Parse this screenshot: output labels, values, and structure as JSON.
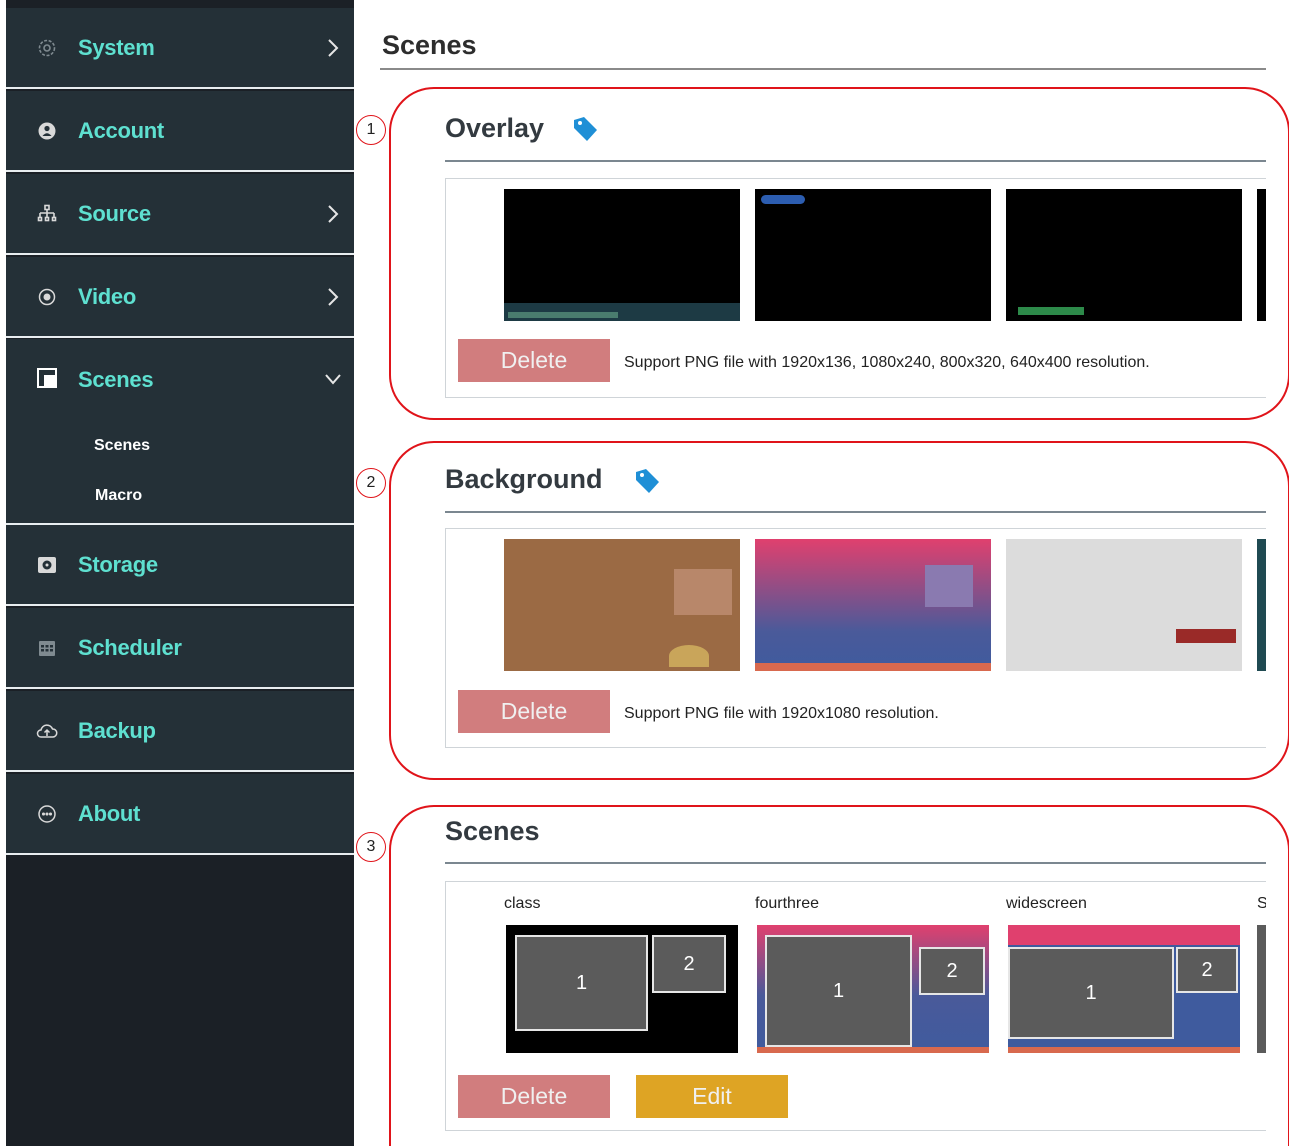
{
  "sidebar": {
    "items": [
      {
        "label": "System",
        "icon": "gear-icon"
      },
      {
        "label": "Account",
        "icon": "user-icon"
      },
      {
        "label": "Source",
        "icon": "network-icon"
      },
      {
        "label": "Video",
        "icon": "record-icon"
      },
      {
        "label": "Scenes",
        "icon": "scenes-icon",
        "expanded": true,
        "children": [
          "Scenes",
          "Macro"
        ]
      },
      {
        "label": "Storage",
        "icon": "disk-icon"
      },
      {
        "label": "Scheduler",
        "icon": "calendar-icon"
      },
      {
        "label": "Backup",
        "icon": "cloud-upload-icon"
      },
      {
        "label": "About",
        "icon": "chat-icon"
      }
    ],
    "accent_color": "#5ee0d0"
  },
  "main": {
    "title": "Scenes",
    "overlay": {
      "title": "Overlay",
      "delete_label": "Delete",
      "support_text": "Support PNG file with 1920x136, 1080x240, 800x320, 640x400 resolution.",
      "marker": "1"
    },
    "background": {
      "title": "Background",
      "delete_label": "Delete",
      "support_text": "Support PNG file with 1920x1080 resolution.",
      "marker": "2"
    },
    "scenes": {
      "title": "Scenes",
      "delete_label": "Delete",
      "edit_label": "Edit",
      "marker": "3",
      "items": [
        {
          "name": "class",
          "box1": "1",
          "box2": "2"
        },
        {
          "name": "fourthree",
          "box1": "1",
          "box2": "2"
        },
        {
          "name": "widescreen",
          "box1": "1",
          "box2": "2"
        },
        {
          "name": "S"
        }
      ]
    }
  }
}
